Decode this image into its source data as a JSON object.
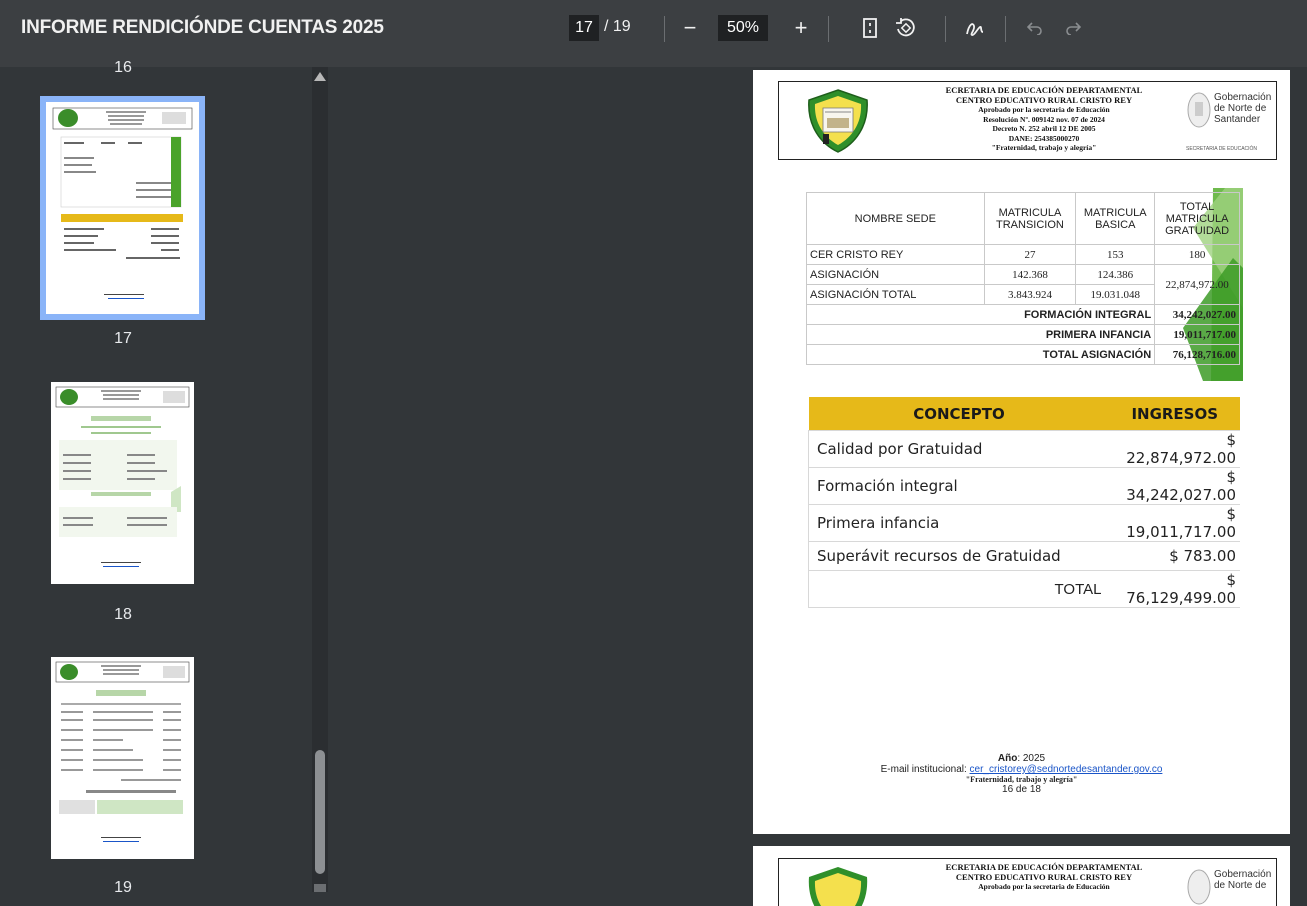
{
  "toolbar": {
    "title": "INFORME RENDICIÓNDE CUENTAS 2025",
    "page_current": "17",
    "page_total": "/ 19",
    "zoom_out": "−",
    "zoom_level": "50%",
    "zoom_in": "+"
  },
  "sidebar": {
    "top_cut_label": "16",
    "thumbs": [
      {
        "label": "17"
      },
      {
        "label": "18"
      },
      {
        "label": "19"
      }
    ]
  },
  "page": {
    "header": {
      "lines": [
        "ECRETARIA DE EDUCACIÓN DEPARTAMENTAL",
        "CENTRO EDUCATIVO RURAL CRISTO REY",
        "Aprobado por la secretaria de Educación",
        "Resolución Nº. 009142 nov. 07 de 2024",
        "Decreto N. 252 abril 12 DE 2005",
        "DANE: 254385000270",
        "\"Fraternidad, trabajo y alegría\""
      ],
      "gob_line1": "Gobernación",
      "gob_line2": "de Norte de",
      "gob_line3": "Santander",
      "gob_small": "SECRETARIA DE EDUCACIÓN"
    },
    "table1": {
      "headers": [
        "NOMBRE SEDE",
        "MATRICULA TRANSICION",
        "MATRICULA BASICA",
        "TOTAL MATRICULA GRATUIDAD"
      ],
      "rows": [
        [
          "CER CRISTO REY",
          "27",
          "153",
          "180"
        ],
        [
          "ASIGNACIÓN",
          "142.368",
          "124.386",
          ""
        ],
        [
          "ASIGNACIÓN TOTAL",
          "3.843.924",
          "19.031.048",
          ""
        ]
      ],
      "merged_total": "22,874,972.00",
      "summary": [
        {
          "label": "FORMACIÓN INTEGRAL",
          "value": "34,242,027.00"
        },
        {
          "label": "PRIMERA INFANCIA",
          "value": "19,011,717.00"
        },
        {
          "label": "TOTAL ASIGNACIÓN",
          "value": "76,128,716.00"
        }
      ]
    },
    "table2": {
      "headers": [
        "CONCEPTO",
        "INGRESOS"
      ],
      "rows": [
        [
          "Calidad por Gratuidad",
          "$ 22,874,972.00"
        ],
        [
          "Formación integral",
          "$ 34,242,027.00"
        ],
        [
          "Primera infancia",
          "$ 19,011,717.00"
        ],
        [
          "Superávit recursos de Gratuidad",
          "$ 783.00"
        ]
      ],
      "total_label": "TOTAL",
      "total_value": "$ 76,129,499.00"
    },
    "footer": {
      "year_label": "Año",
      "year_value": ": 2025",
      "email_label": "E-mail institucional: ",
      "email": "cer_cristorey@sednortedesantander.gov.co",
      "motto": "\"Fraternidad, trabajo y alegría\"",
      "page_of": "16 de 18"
    }
  },
  "colors": {
    "toolbar_bg": "#3c3f42",
    "canvas_bg": "#323639",
    "accent_thumb": "#8ab4f8",
    "table_header_gold": "#e6b919",
    "green_band": "#4aa32a"
  }
}
